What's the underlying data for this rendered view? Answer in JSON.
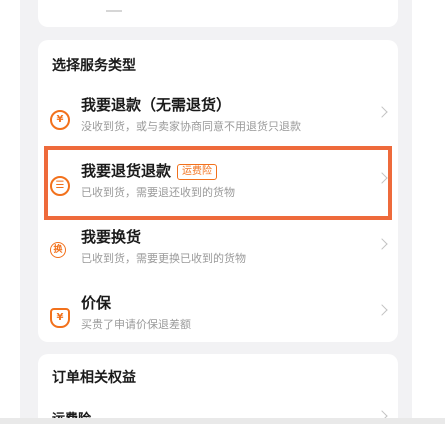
{
  "service_section": {
    "title": "选择服务类型",
    "options": [
      {
        "icon": "yen-circle-icon",
        "icon_glyph": "¥",
        "title": "我要退款（无需退货）",
        "subtitle": "没收到货，或与卖家协商同意不用退货只退款"
      },
      {
        "icon": "return-box-icon",
        "icon_glyph": "☰",
        "title": "我要退货退款",
        "tag": "运费险",
        "subtitle": "已收到货，需要退还收到的货物"
      },
      {
        "icon": "exchange-icon",
        "icon_glyph": "换",
        "title": "我要换货",
        "subtitle": "已收到货，需要更换已收到的货物"
      },
      {
        "icon": "price-protect-shield-icon",
        "icon_glyph": "¥",
        "title": "价保",
        "subtitle": "买贵了申请价保退差额"
      }
    ]
  },
  "benefit_section": {
    "title": "订单相关权益",
    "first_row_partial": "运费险"
  },
  "colors": {
    "accent": "#f2711c",
    "highlight_frame": "#ee6a3b"
  }
}
